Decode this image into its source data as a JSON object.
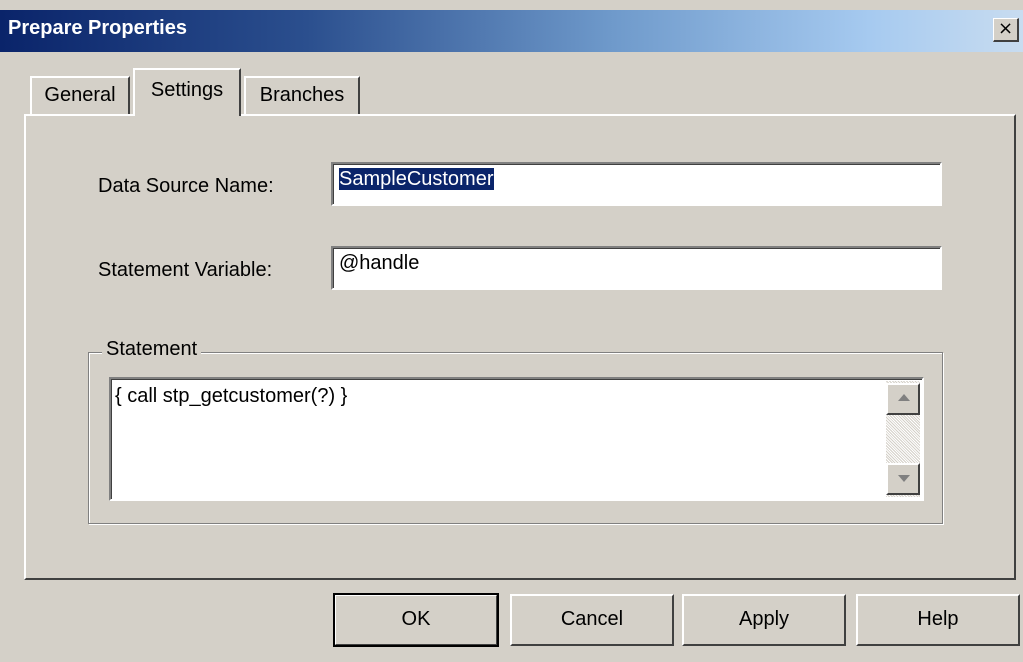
{
  "window": {
    "title": "Prepare Properties",
    "close_label": "×"
  },
  "tabs": [
    {
      "label": "General",
      "selected": false
    },
    {
      "label": "Settings",
      "selected": true
    },
    {
      "label": "Branches",
      "selected": false
    }
  ],
  "fields": {
    "data_source_name": {
      "label": "Data Source Name:",
      "value": "SampleCustomer",
      "selected_text": true
    },
    "statement_variable": {
      "label": "Statement Variable:",
      "value": "@handle"
    }
  },
  "statement_group": {
    "legend": "Statement",
    "value": "{ call stp_getcustomer(?) }"
  },
  "buttons": {
    "ok": "OK",
    "cancel": "Cancel",
    "apply": "Apply",
    "help": "Help"
  },
  "colors": {
    "title_bar_start": "#0a246a",
    "dialog_bg": "#d4d0c8",
    "selection": "#0a246a"
  }
}
